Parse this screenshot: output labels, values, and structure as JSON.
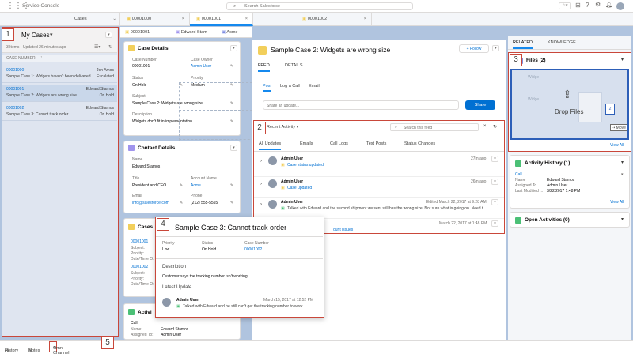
{
  "topbar": {
    "app_name": "Service Console",
    "search_placeholder": "Search Salesforce"
  },
  "tabs": [
    {
      "label": "Cases"
    },
    {
      "label": "00001000"
    },
    {
      "label": "00001001"
    },
    {
      "label": "00001002"
    }
  ],
  "subtabs": [
    {
      "label": "00001001"
    },
    {
      "label": "Edward Stam"
    },
    {
      "label": "Acme"
    }
  ],
  "list": {
    "title": "My Cases",
    "meta": "3 Items · Updated 26 minutes ago",
    "col": "CASE NUMBER",
    "items": [
      {
        "num": "00001000",
        "owner": "Jon Amos",
        "subject": "Sample Case 1: Widgets haven't been delivered",
        "status": "Escalated"
      },
      {
        "num": "00001001",
        "owner": "Edward Stamos",
        "subject": "Sample Case 2: Widgets are wrong size",
        "status": "On Hold"
      },
      {
        "num": "00001002",
        "owner": "Edward Stamos",
        "subject": "Sample Case 3: Cannot track order",
        "status": "On Hold"
      }
    ]
  },
  "case_details": {
    "title": "Case Details",
    "case_number_label": "Case Number",
    "case_number": "00001001",
    "owner_label": "Case Owner",
    "owner": "Admin User",
    "status_label": "Status",
    "status": "On Hold",
    "priority_label": "Priority",
    "priority": "Medium",
    "subject_label": "Subject",
    "subject": "Sample Case 2: Widgets are wrong size",
    "desc_label": "Description",
    "desc": "Widgets don't fit in implementation"
  },
  "contact_details": {
    "title": "Contact Details",
    "name_label": "Name",
    "name": "Edward Stamos",
    "title_label": "Title",
    "title_val": "President and CEO",
    "account_label": "Account Name",
    "account": "Acme",
    "email_label": "Email",
    "email": "info@salesforce.com",
    "phone_label": "Phone",
    "phone": "(212) 555-5555"
  },
  "cases_card": {
    "title": "Cases",
    "c1": "00001001",
    "c2": "00001002",
    "subject": "Subject:",
    "priority": "Priority:",
    "date": "Date/Time O:"
  },
  "activity_card": {
    "title": "Activi",
    "call": "Call",
    "name_label": "Name:",
    "name": "Edward Stamos",
    "assigned_label": "Assigned To:",
    "assigned": "Admin User"
  },
  "case": {
    "title": "Sample Case 2: Widgets are wrong size",
    "follow": "+ Follow",
    "tab_feed": "FEED",
    "tab_details": "DETAILS",
    "post": "Post",
    "log": "Log a Call",
    "email": "Email",
    "share_placeholder": "Share an update...",
    "share": "Share"
  },
  "feed": {
    "sort": "Recent Activity",
    "search_placeholder": "Search this feed",
    "filters": [
      "All Updates",
      "Emails",
      "Call Logs",
      "Text Posts",
      "Status Changes"
    ],
    "items": [
      {
        "user": "Admin User",
        "action": "Case status updated",
        "time": "27m ago"
      },
      {
        "user": "Admin User",
        "action": "Case updated",
        "time": "26m ago"
      },
      {
        "user": "Admin User",
        "time": "Edited March 22, 2017 at 9:28 AM",
        "text": "Talked with Edward and the second shipment we sent still has the wrong size. Not sure what is going on. Need t..."
      },
      {
        "time": "March 22, 2017 at 1:48 PM"
      }
    ],
    "partial": "ount issues"
  },
  "right": {
    "tab_related": "RELATED",
    "tab_knowledge": "KNOWLEDGE",
    "files_title": "Files (2)",
    "file1": "Widge",
    "file2": "Widge",
    "drop": "Drop Files",
    "move": "Move",
    "file_icon": "2",
    "view_all": "View All",
    "activity_title": "Activity History (1)",
    "ah_call": "Call",
    "ah_name_label": "Name",
    "ah_name": "Edward Stamos",
    "ah_assigned_label": "Assigned To",
    "ah_assigned": "Admin User",
    "ah_modified_label": "Last Modified ...",
    "ah_modified": "3/22/2017 1:48 PM",
    "ah_view_all": "View All",
    "open_title": "Open Activities (0)"
  },
  "popover": {
    "title": "Sample Case 3: Cannot track order",
    "priority_label": "Priority",
    "priority": "Low",
    "status_label": "Status",
    "status": "On Hold",
    "number_label": "Case Number",
    "number": "00001002",
    "desc_label": "Description",
    "desc": "Customer says the tracking number isn't working",
    "update_label": "Latest Update",
    "user": "Admin User",
    "time": "March 15, 2017 at 12:52 PM",
    "text": "Talked with Edward and he still can't get the tracking number to work"
  },
  "utility": {
    "history": "History",
    "notes": "Notes",
    "omni": "Omni-Channel (Beta)"
  },
  "callouts": [
    "1",
    "2",
    "3",
    "4",
    "5"
  ],
  "colors": {
    "brand": "#0070d2",
    "callout": "#c9473a",
    "highlight": "#2d5fb8",
    "background": "#b0c4df"
  }
}
